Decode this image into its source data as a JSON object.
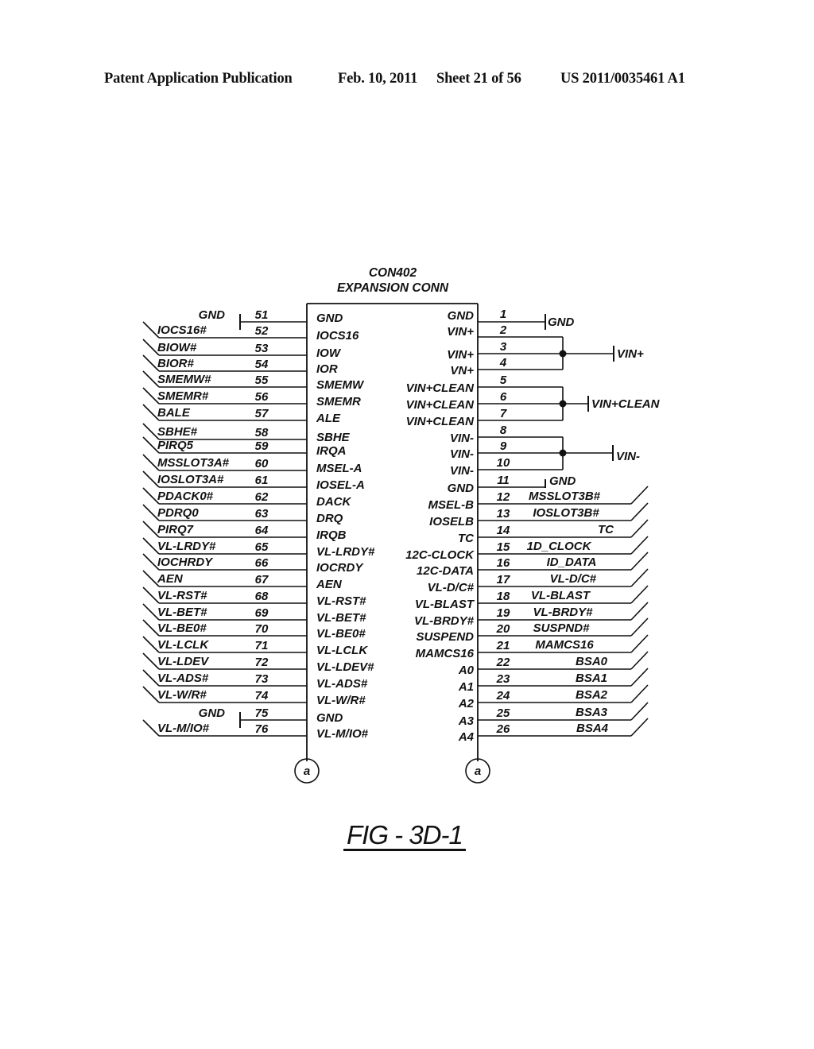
{
  "header": {
    "publication": "Patent Application Publication",
    "date": "Feb. 10, 2011",
    "sheet": "Sheet 21 of 56",
    "number": "US 2011/0035461 A1"
  },
  "connector": {
    "ref": "CON402",
    "name": "EXPANSION CONN",
    "left_pins": [
      {
        "pin": "51",
        "inner": "GND",
        "outer": "",
        "kind": "gnd",
        "outer_label": "GND"
      },
      {
        "pin": "52",
        "inner": "IOCS16",
        "outer": "IOCS16#",
        "kind": "bus"
      },
      {
        "pin": "53",
        "inner": "IOW",
        "outer": "BIOW#",
        "kind": "bus"
      },
      {
        "pin": "54",
        "inner": "IOR",
        "outer": "BIOR#",
        "kind": "bus"
      },
      {
        "pin": "55",
        "inner": "SMEMW",
        "outer": "SMEMW#",
        "kind": "bus"
      },
      {
        "pin": "56",
        "inner": "SMEMR",
        "outer": "SMEMR#",
        "kind": "bus"
      },
      {
        "pin": "57",
        "inner": "ALE",
        "outer": "BALE",
        "kind": "bus"
      },
      {
        "pin": "58",
        "inner": "SBHE",
        "outer": "SBHE#",
        "kind": "bus"
      },
      {
        "pin": "59",
        "inner": "IRQA",
        "outer": "PIRQ5",
        "kind": "bus"
      },
      {
        "pin": "60",
        "inner": "MSEL-A",
        "outer": "MSSLOT3A#",
        "kind": "bus"
      },
      {
        "pin": "61",
        "inner": "IOSEL-A",
        "outer": "IOSLOT3A#",
        "kind": "bus"
      },
      {
        "pin": "62",
        "inner": "DACK",
        "outer": "PDACK0#",
        "kind": "bus"
      },
      {
        "pin": "63",
        "inner": "DRQ",
        "outer": "PDRQ0",
        "kind": "bus"
      },
      {
        "pin": "64",
        "inner": "IRQB",
        "outer": "PIRQ7",
        "kind": "bus"
      },
      {
        "pin": "65",
        "inner": "VL-LRDY#",
        "outer": "VL-LRDY#",
        "kind": "bus"
      },
      {
        "pin": "66",
        "inner": "IOCRDY",
        "outer": "IOCHRDY",
        "kind": "bus"
      },
      {
        "pin": "67",
        "inner": "AEN",
        "outer": "AEN",
        "kind": "bus"
      },
      {
        "pin": "68",
        "inner": "VL-RST#",
        "outer": "VL-RST#",
        "kind": "bus"
      },
      {
        "pin": "69",
        "inner": "VL-BET#",
        "outer": "VL-BET#",
        "kind": "bus"
      },
      {
        "pin": "70",
        "inner": "VL-BE0#",
        "outer": "VL-BE0#",
        "kind": "bus"
      },
      {
        "pin": "71",
        "inner": "VL-LCLK",
        "outer": "VL-LCLK",
        "kind": "bus"
      },
      {
        "pin": "72",
        "inner": "VL-LDEV#",
        "outer": "VL-LDEV",
        "kind": "bus"
      },
      {
        "pin": "73",
        "inner": "VL-ADS#",
        "outer": "VL-ADS#",
        "kind": "bus"
      },
      {
        "pin": "74",
        "inner": "VL-W/R#",
        "outer": "VL-W/R#",
        "kind": "bus"
      },
      {
        "pin": "75",
        "inner": "GND",
        "outer": "",
        "kind": "gnd",
        "outer_label": "GND"
      },
      {
        "pin": "76",
        "inner": "VL-M/IO#",
        "outer": "VL-M/IO#",
        "kind": "bus"
      }
    ],
    "right_pins": [
      {
        "pin": "1",
        "inner": "GND",
        "outer": "",
        "kind": "gnd"
      },
      {
        "pin": "2",
        "inner": "VIN+",
        "outer": "",
        "kind": "gnd"
      },
      {
        "pin": "3",
        "inner": "VIN+",
        "outer": "",
        "kind": "vin"
      },
      {
        "pin": "4",
        "inner": "VN+",
        "outer": "",
        "kind": "vin"
      },
      {
        "pin": "5",
        "inner": "VIN+CLEAN",
        "outer": "",
        "kind": "vinc"
      },
      {
        "pin": "6",
        "inner": "VIN+CLEAN",
        "outer": "",
        "kind": "vinc"
      },
      {
        "pin": "7",
        "inner": "VIN+CLEAN",
        "outer": "",
        "kind": "vinc"
      },
      {
        "pin": "8",
        "inner": "VIN-",
        "outer": "",
        "kind": "vinm"
      },
      {
        "pin": "9",
        "inner": "VIN-",
        "outer": "",
        "kind": "vinm"
      },
      {
        "pin": "10",
        "inner": "VIN-",
        "outer": "",
        "kind": "vinm"
      },
      {
        "pin": "11",
        "inner": "GND",
        "outer": "",
        "kind": "gnd2"
      },
      {
        "pin": "12",
        "inner": "MSEL-B",
        "outer": "MSSLOT3B#",
        "kind": "bus"
      },
      {
        "pin": "13",
        "inner": "IOSELB",
        "outer": "IOSLOT3B#",
        "kind": "bus"
      },
      {
        "pin": "14",
        "inner": "TC",
        "outer": "TC",
        "kind": "bus"
      },
      {
        "pin": "15",
        "inner": "12C-CLOCK",
        "outer": "1D_CLOCK",
        "kind": "bus"
      },
      {
        "pin": "16",
        "inner": "12C-DATA",
        "outer": "ID_DATA",
        "kind": "bus"
      },
      {
        "pin": "17",
        "inner": "VL-D/C#",
        "outer": "VL-D/C#",
        "kind": "bus"
      },
      {
        "pin": "18",
        "inner": "VL-BLAST",
        "outer": "VL-BLAST",
        "kind": "bus"
      },
      {
        "pin": "19",
        "inner": "VL-BRDY#",
        "outer": "VL-BRDY#",
        "kind": "bus"
      },
      {
        "pin": "20",
        "inner": "SUSPEND",
        "outer": "SUSPND#",
        "kind": "bus"
      },
      {
        "pin": "21",
        "inner": "MAMCS16",
        "outer": "MAMCS16",
        "kind": "bus"
      },
      {
        "pin": "22",
        "inner": "A0",
        "outer": "BSA0",
        "kind": "bus"
      },
      {
        "pin": "23",
        "inner": "A1",
        "outer": "BSA1",
        "kind": "bus"
      },
      {
        "pin": "24",
        "inner": "A2",
        "outer": "BSA2",
        "kind": "bus"
      },
      {
        "pin": "25",
        "inner": "A3",
        "outer": "BSA3",
        "kind": "bus"
      },
      {
        "pin": "26",
        "inner": "A4",
        "outer": "BSA4",
        "kind": "bus"
      }
    ],
    "power_nets": {
      "gnd_right": "GND",
      "vin_plus": "VIN+",
      "vin_clean": "VIN+CLEAN",
      "vin_minus": "VIN-",
      "gnd_11": "GND"
    },
    "off_page_connector": "a"
  },
  "figure_label": "FIG - 3D-1"
}
